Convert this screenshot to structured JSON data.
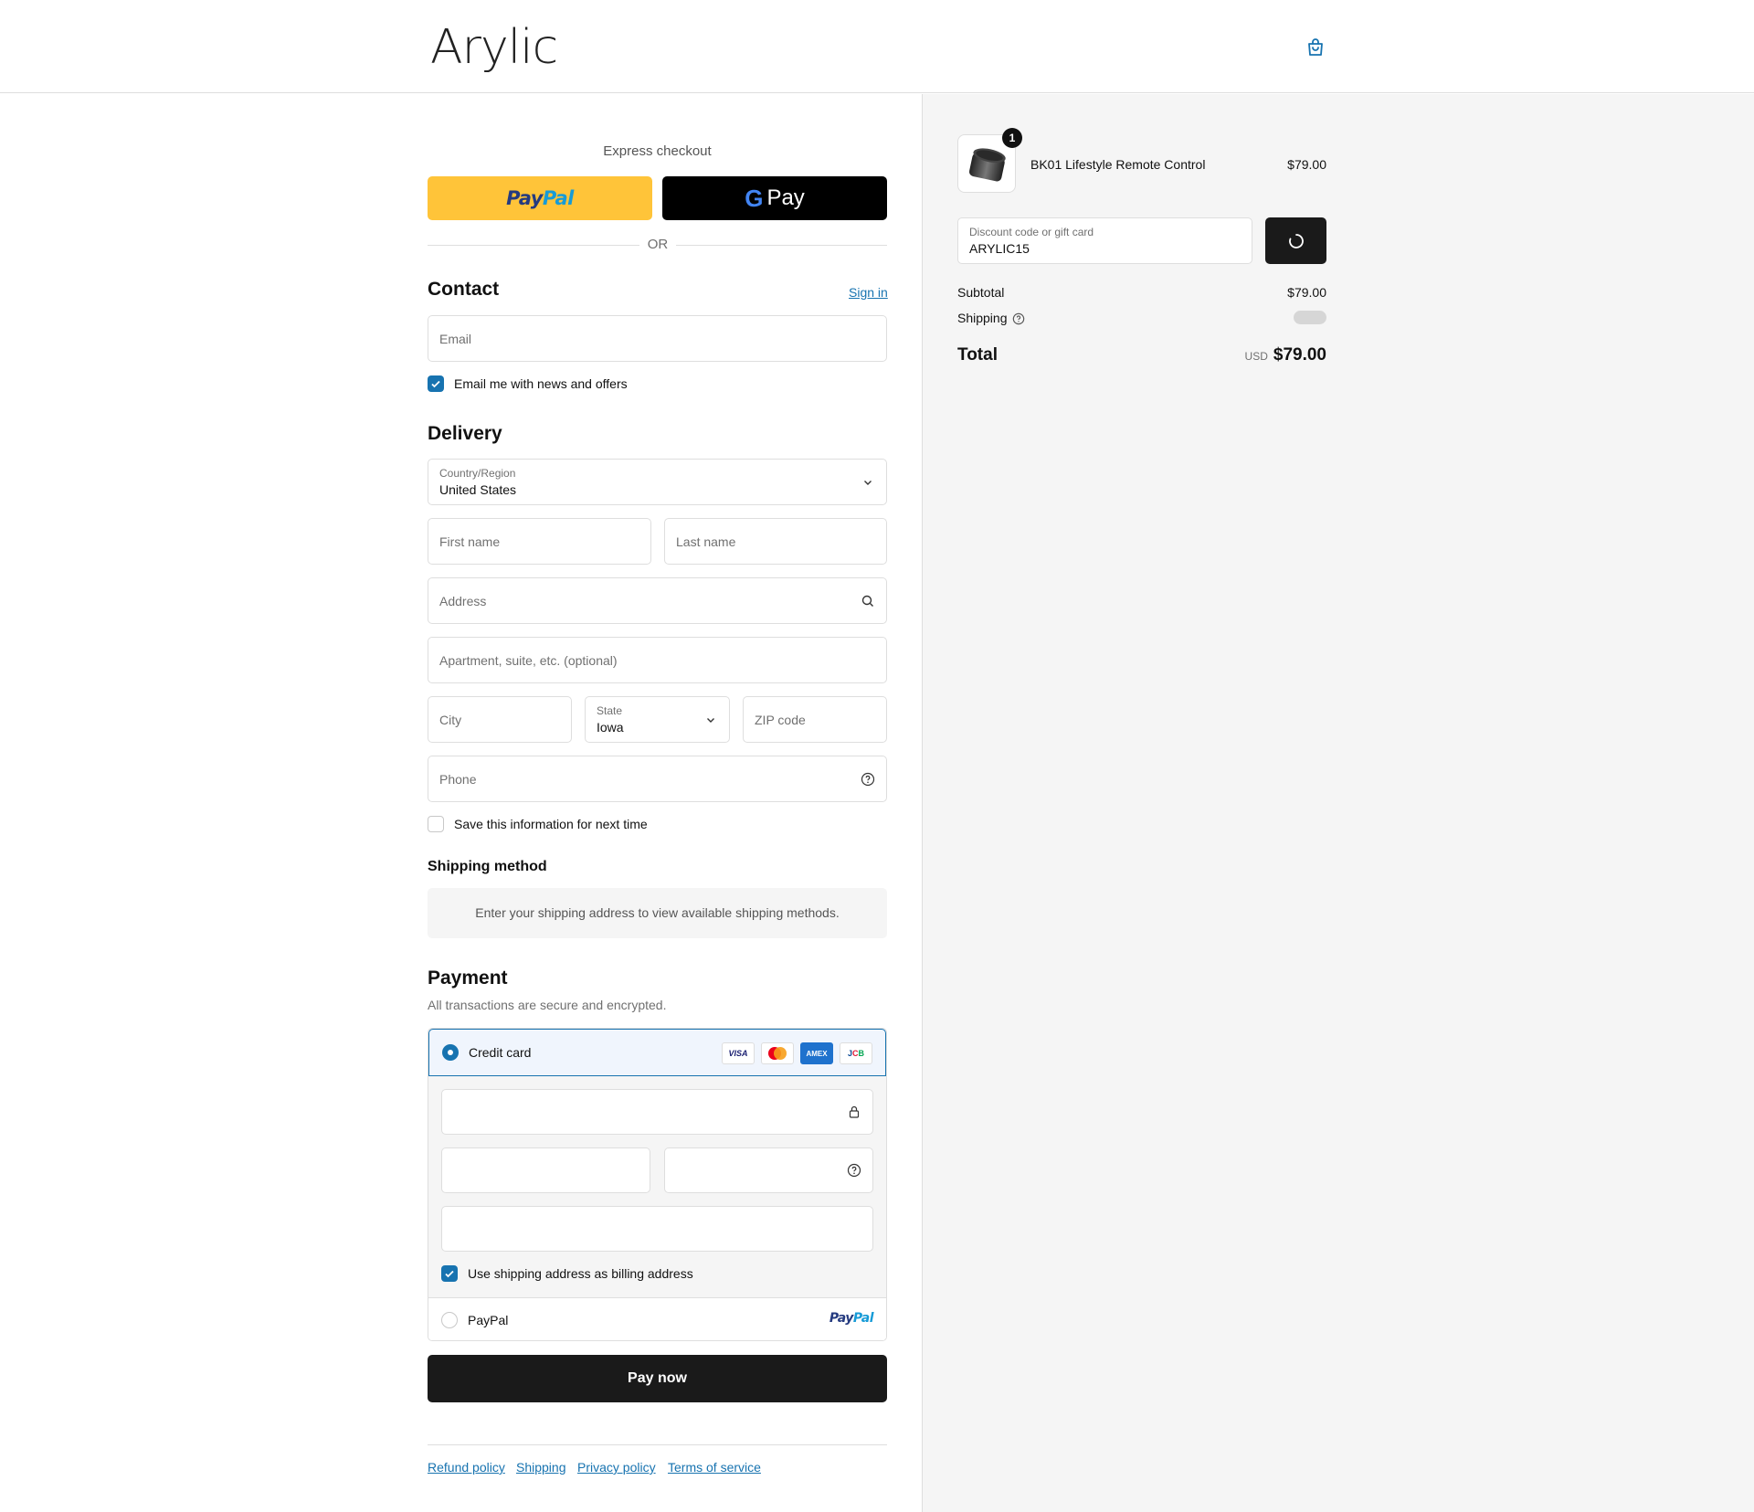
{
  "header": {
    "logo_text": "Arylic",
    "cart_icon": "shopping-bag-icon"
  },
  "express": {
    "title": "Express checkout",
    "paypal_part1": "Pay",
    "paypal_part2": "Pal",
    "gpay_g": "G",
    "gpay_label": "Pay",
    "or_text": "OR"
  },
  "contact": {
    "title": "Contact",
    "sign_in": "Sign in",
    "email_placeholder": "Email",
    "news_checkbox_label": "Email me with news and offers",
    "news_checked": true
  },
  "delivery": {
    "title": "Delivery",
    "country_label": "Country/Region",
    "country_value": "United States",
    "first_name_placeholder": "First name",
    "last_name_placeholder": "Last name",
    "address_placeholder": "Address",
    "apartment_placeholder": "Apartment, suite, etc. (optional)",
    "city_placeholder": "City",
    "state_label": "State",
    "state_value": "Iowa",
    "zip_placeholder": "ZIP code",
    "phone_placeholder": "Phone",
    "save_info_label": "Save this information for next time",
    "save_info_checked": false
  },
  "shipping_method": {
    "title": "Shipping method",
    "message": "Enter your shipping address to view available shipping methods."
  },
  "payment": {
    "title": "Payment",
    "subtitle": "All transactions are secure and encrypted.",
    "credit_card_label": "Credit card",
    "card_brands": [
      "VISA",
      "Mastercard",
      "AMEX",
      "JCB"
    ],
    "billing_checkbox_label": "Use shipping address as billing address",
    "billing_checked": true,
    "paypal_label": "PayPal",
    "paypal_logo_part1": "Pay",
    "paypal_logo_part2": "Pal"
  },
  "pay_button": "Pay now",
  "footer_links": [
    "Refund policy",
    "Shipping",
    "Privacy policy",
    "Terms of service"
  ],
  "summary": {
    "product_name": "BK01 Lifestyle Remote Control",
    "product_price": "$79.00",
    "quantity": "1",
    "discount_label": "Discount code or gift card",
    "discount_value": "ARYLIC15",
    "subtotal_label": "Subtotal",
    "subtotal_value": "$79.00",
    "shipping_label": "Shipping",
    "total_label": "Total",
    "currency": "USD",
    "total_value": "$79.00"
  },
  "colors": {
    "accent": "#1773b0",
    "paypal_yellow": "#ffc439",
    "button_dark": "#1a1a1a",
    "sidebar_bg": "#f5f5f5"
  }
}
